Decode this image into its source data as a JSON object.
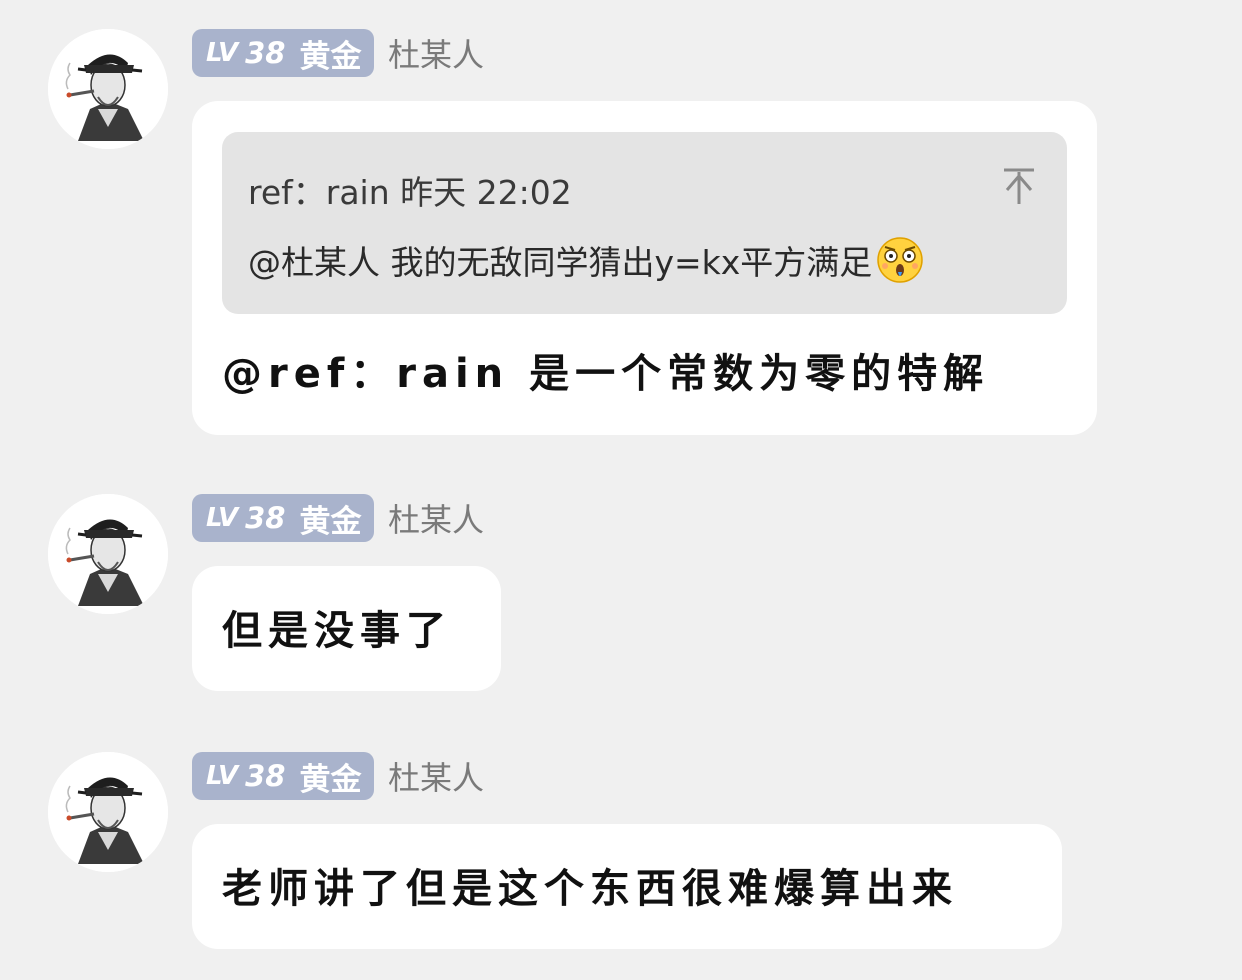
{
  "messages": [
    {
      "badge": {
        "lv": "LV",
        "level": "38",
        "tier": "黄金"
      },
      "username": "杜某人",
      "quote": {
        "header": "ref：rain 昨天 22:02",
        "body": "@杜某人 我的无敌同学猜出y=kx平方满足",
        "emoji": "shocked-face-emoji"
      },
      "text": "@ref：rain 是一个常数为零的特解"
    },
    {
      "badge": {
        "lv": "LV",
        "level": "38",
        "tier": "黄金"
      },
      "username": "杜某人",
      "text": "但是没事了"
    },
    {
      "badge": {
        "lv": "LV",
        "level": "38",
        "tier": "黄金"
      },
      "username": "杜某人",
      "text": "老师讲了但是这个东西很难爆算出来"
    }
  ],
  "colors": {
    "background": "#f0f0f0",
    "bubble": "#ffffff",
    "quote": "#e4e4e4",
    "badge": "#a9b3cc",
    "username": "#7a7a7a"
  }
}
